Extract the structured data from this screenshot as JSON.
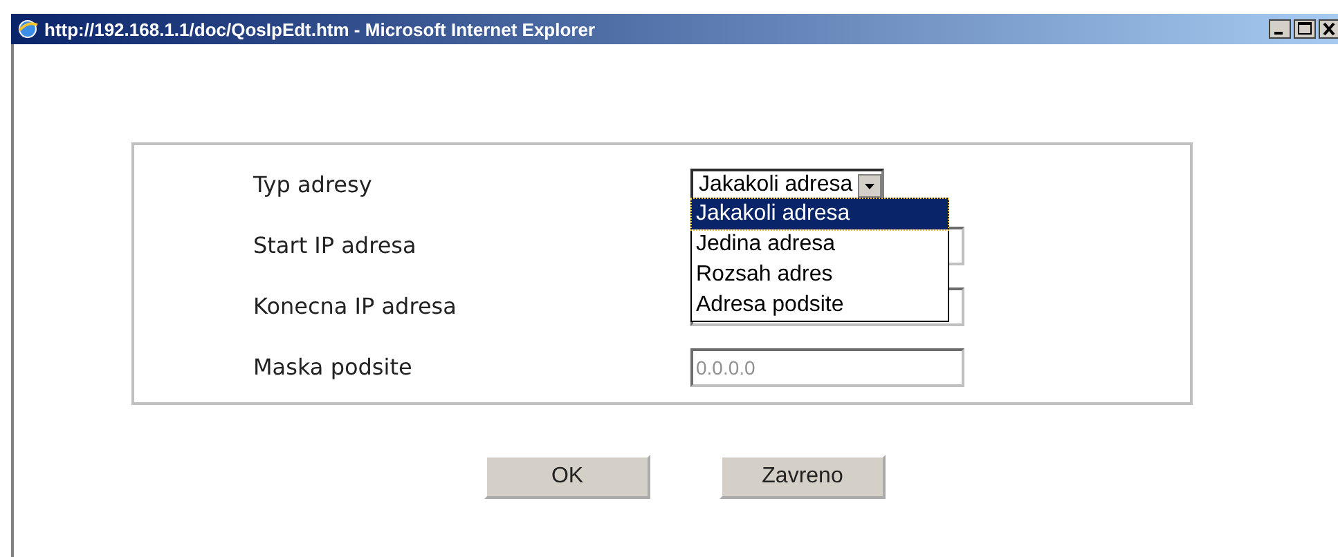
{
  "window": {
    "title": "http://192.168.1.1/doc/QosIpEdt.htm - Microsoft Internet Explorer"
  },
  "form": {
    "rows": [
      {
        "kind": "select",
        "label": "Typ adresy",
        "value": "Jakakoli adresa",
        "expanded": true,
        "options": [
          {
            "label": "Jakakoli adresa",
            "selected": true
          },
          {
            "label": "Jedina adresa",
            "selected": false
          },
          {
            "label": "Rozsah adres",
            "selected": false
          },
          {
            "label": "Adresa podsite",
            "selected": false
          }
        ]
      },
      {
        "kind": "input",
        "label": "Start IP adresa"
      },
      {
        "kind": "input",
        "label": "Konecna IP adresa"
      },
      {
        "kind": "input",
        "label": "Maska podsite",
        "value": "0.0.0.0",
        "disabled": true
      }
    ]
  },
  "buttons": [
    "OK",
    "Zavreno"
  ]
}
